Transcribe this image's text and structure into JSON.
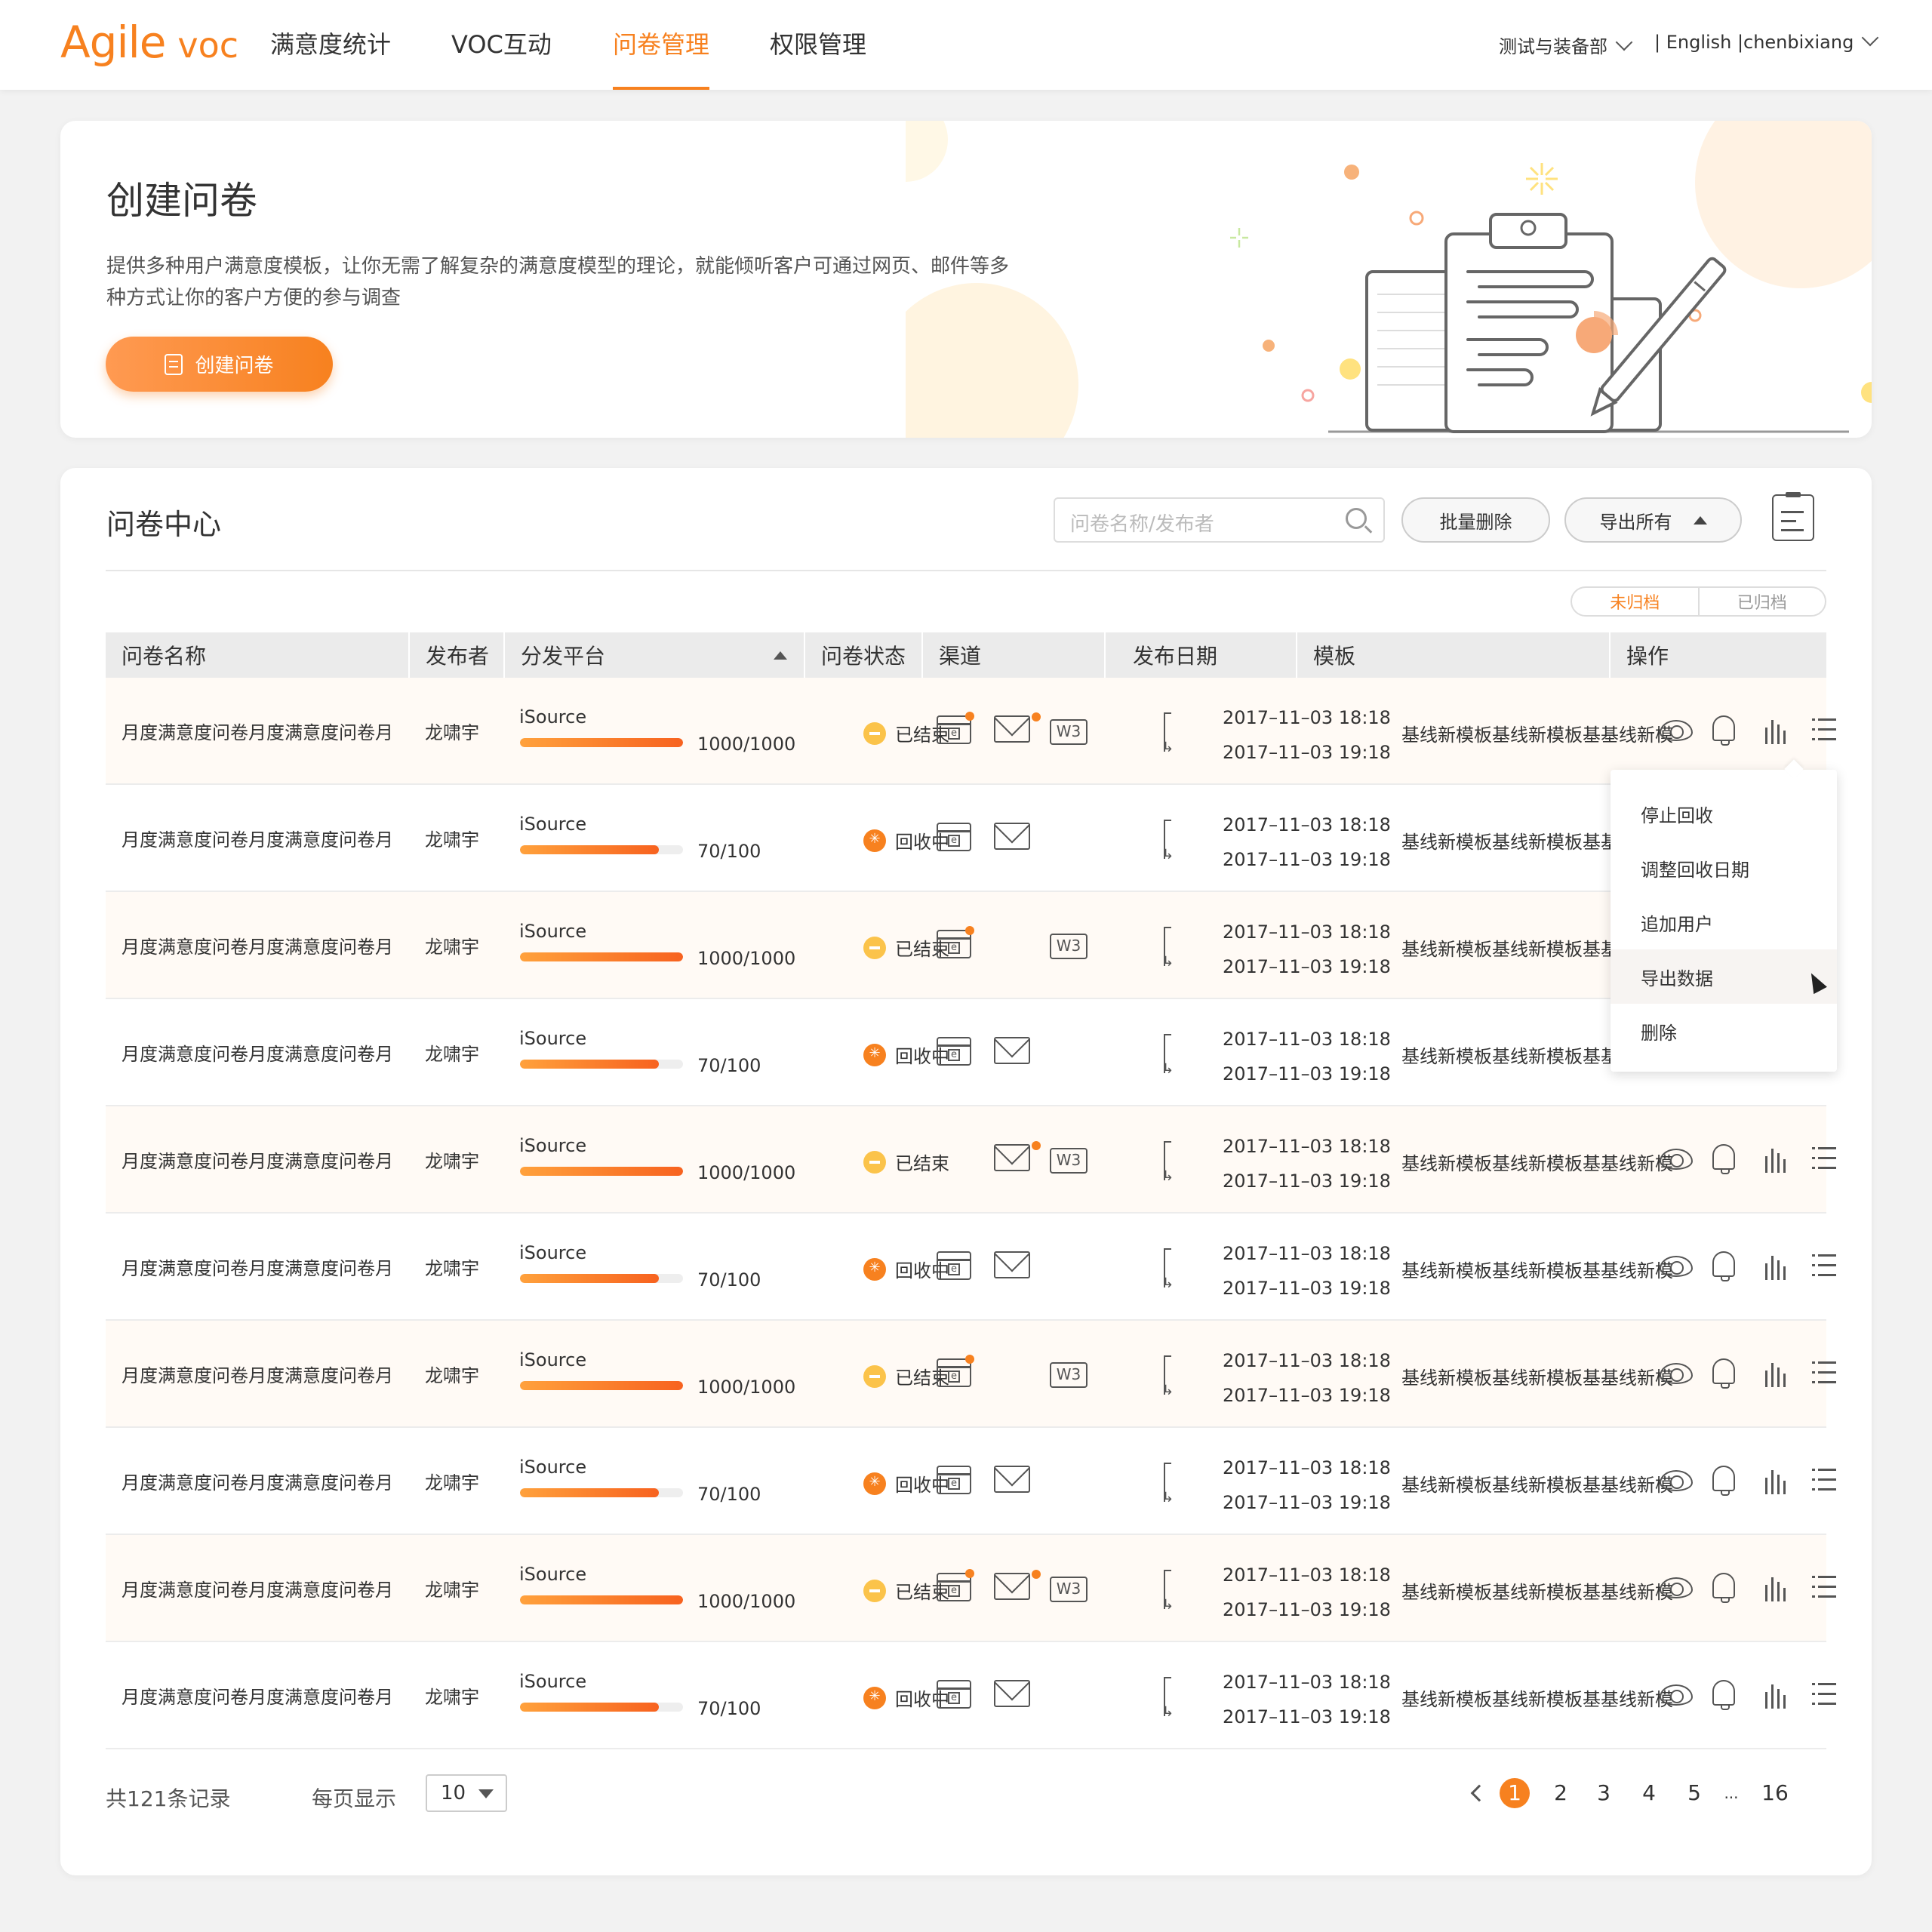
{
  "app": {
    "brand": "Agile",
    "product": "voc"
  },
  "nav": {
    "items": [
      "满意度统计",
      "VOC互动",
      "问卷管理",
      "权限管理"
    ],
    "active_index": 2,
    "department": "测试与装备部",
    "language": "| English |",
    "user": "chenbixiang"
  },
  "banner": {
    "title": "创建问卷",
    "description": "提供多种用户满意度模板，让你无需了解复杂的满意度模型的理论，就能倾听客户可通过网页、邮件等多种方式让你的客户方便的参与调查",
    "button_label": "创建问卷"
  },
  "center": {
    "title": "问卷中心",
    "search_placeholder": "问卷名称/发布者",
    "batch_delete_label": "批量删除",
    "export_all_label": "导出所有",
    "archive_tabs": [
      "未归档",
      "已归档"
    ],
    "active_archive_tab": 0
  },
  "table": {
    "columns": [
      "问卷名称",
      "发布者",
      "分发平台",
      "问卷状态",
      "渠道",
      "发布日期",
      "模板",
      "操作"
    ],
    "rows": [
      {
        "name": "月度满意度问卷月度满意度问卷月",
        "publisher": "龙啸宇",
        "platform": "iSource",
        "progress_fraction": 1.0,
        "count": "1000/1000",
        "status": "已结束",
        "status_type": "ended",
        "channels": {
          "web": true,
          "web_badge": true,
          "mail": true,
          "mail_badge": true,
          "w3": true
        },
        "start": "2017–11–03 18:18",
        "end": "2017–11–03 19:18",
        "template": "基线新模板基线新模板基基线新模"
      },
      {
        "name": "月度满意度问卷月度满意度问卷月",
        "publisher": "龙啸宇",
        "platform": "iSource",
        "progress_fraction": 0.85,
        "count": "70/100",
        "status": "回收中",
        "status_type": "active",
        "channels": {
          "web": true,
          "web_badge": false,
          "mail": true,
          "mail_badge": false,
          "w3": false
        },
        "start": "2017–11–03 18:18",
        "end": "2017–11–03 19:18",
        "template": "基线新模板基线新模板基基线新模"
      },
      {
        "name": "月度满意度问卷月度满意度问卷月",
        "publisher": "龙啸宇",
        "platform": "iSource",
        "progress_fraction": 1.0,
        "count": "1000/1000",
        "status": "已结束",
        "status_type": "ended",
        "channels": {
          "web": true,
          "web_badge": true,
          "mail": false,
          "mail_badge": false,
          "w3": true
        },
        "start": "2017–11–03 18:18",
        "end": "2017–11–03 19:18",
        "template": "基线新模板基线新模板基基线新模"
      },
      {
        "name": "月度满意度问卷月度满意度问卷月",
        "publisher": "龙啸宇",
        "platform": "iSource",
        "progress_fraction": 0.85,
        "count": "70/100",
        "status": "回收中",
        "status_type": "active",
        "channels": {
          "web": true,
          "web_badge": false,
          "mail": true,
          "mail_badge": false,
          "w3": false
        },
        "start": "2017–11–03 18:18",
        "end": "2017–11–03 19:18",
        "template": "基线新模板基线新模板基基线新模"
      },
      {
        "name": "月度满意度问卷月度满意度问卷月",
        "publisher": "龙啸宇",
        "platform": "iSource",
        "progress_fraction": 1.0,
        "count": "1000/1000",
        "status": "已结束",
        "status_type": "ended",
        "channels": {
          "web": false,
          "web_badge": false,
          "mail": true,
          "mail_badge": true,
          "w3": true
        },
        "start": "2017–11–03 18:18",
        "end": "2017–11–03 19:18",
        "template": "基线新模板基线新模板基基线新模"
      },
      {
        "name": "月度满意度问卷月度满意度问卷月",
        "publisher": "龙啸宇",
        "platform": "iSource",
        "progress_fraction": 0.85,
        "count": "70/100",
        "status": "回收中",
        "status_type": "active",
        "channels": {
          "web": true,
          "web_badge": false,
          "mail": true,
          "mail_badge": false,
          "w3": false
        },
        "start": "2017–11–03 18:18",
        "end": "2017–11–03 19:18",
        "template": "基线新模板基线新模板基基线新模"
      },
      {
        "name": "月度满意度问卷月度满意度问卷月",
        "publisher": "龙啸宇",
        "platform": "iSource",
        "progress_fraction": 1.0,
        "count": "1000/1000",
        "status": "已结束",
        "status_type": "ended",
        "channels": {
          "web": true,
          "web_badge": true,
          "mail": false,
          "mail_badge": false,
          "w3": true
        },
        "start": "2017–11–03 18:18",
        "end": "2017–11–03 19:18",
        "template": "基线新模板基线新模板基基线新模"
      },
      {
        "name": "月度满意度问卷月度满意度问卷月",
        "publisher": "龙啸宇",
        "platform": "iSource",
        "progress_fraction": 0.85,
        "count": "70/100",
        "status": "回收中",
        "status_type": "active",
        "channels": {
          "web": true,
          "web_badge": false,
          "mail": true,
          "mail_badge": false,
          "w3": false
        },
        "start": "2017–11–03 18:18",
        "end": "2017–11–03 19:18",
        "template": "基线新模板基线新模板基基线新模"
      },
      {
        "name": "月度满意度问卷月度满意度问卷月",
        "publisher": "龙啸宇",
        "platform": "iSource",
        "progress_fraction": 1.0,
        "count": "1000/1000",
        "status": "已结束",
        "status_type": "ended",
        "channels": {
          "web": true,
          "web_badge": true,
          "mail": true,
          "mail_badge": true,
          "w3": true
        },
        "start": "2017–11–03 18:18",
        "end": "2017–11–03 19:18",
        "template": "基线新模板基线新模板基基线新模"
      },
      {
        "name": "月度满意度问卷月度满意度问卷月",
        "publisher": "龙啸宇",
        "platform": "iSource",
        "progress_fraction": 0.85,
        "count": "70/100",
        "status": "回收中",
        "status_type": "active",
        "channels": {
          "web": true,
          "web_badge": false,
          "mail": true,
          "mail_badge": false,
          "w3": false
        },
        "start": "2017–11–03 18:18",
        "end": "2017–11–03 19:18",
        "template": "基线新模板基线新模板基基线新模"
      }
    ]
  },
  "dropdown": {
    "items": [
      "停止回收",
      "调整回收日期",
      "追加用户",
      "导出数据",
      "删除"
    ],
    "hovered_index": 3
  },
  "footer": {
    "total": "共121条记录",
    "per_page_label": "每页显示",
    "per_page_value": "10",
    "pages": [
      "1",
      "2",
      "3",
      "4",
      "5",
      "...",
      "16"
    ],
    "current_page": "1"
  },
  "colors": {
    "accent": "#f7811f",
    "ended": "#fbc34a",
    "background": "#f2f2f2"
  }
}
